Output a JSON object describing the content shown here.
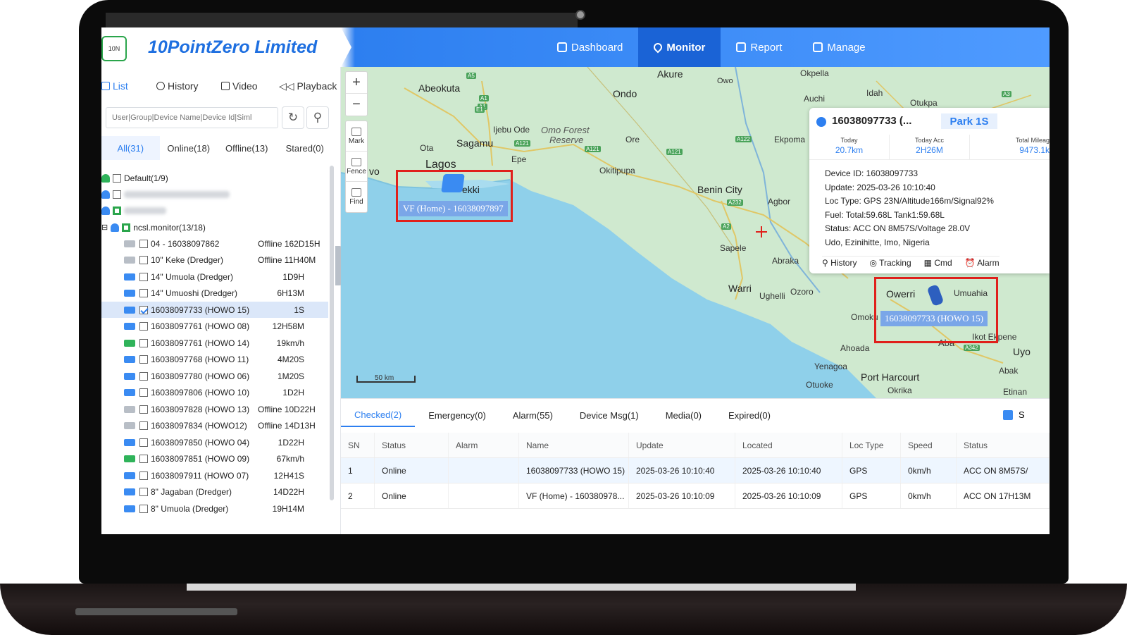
{
  "app": {
    "brand": "10PointZero Limited",
    "logo_text": "10N"
  },
  "nav": [
    {
      "label": "Dashboard",
      "icon": "monitor-icon",
      "active": false
    },
    {
      "label": "Monitor",
      "icon": "map-pin-icon",
      "active": true
    },
    {
      "label": "Report",
      "icon": "report-icon",
      "active": false
    },
    {
      "label": "Manage",
      "icon": "grid-icon",
      "active": false
    }
  ],
  "sidebar": {
    "tabs": [
      {
        "label": "List",
        "active": true
      },
      {
        "label": "History",
        "active": false
      },
      {
        "label": "Video",
        "active": false
      },
      {
        "label": "Playback",
        "active": false
      }
    ],
    "search_placeholder": "User|Group|Device Name|Device Id|Siml",
    "filters": [
      {
        "label": "All(31)",
        "active": true
      },
      {
        "label": "Online(18)",
        "active": false
      },
      {
        "label": "Offline(13)",
        "active": false
      },
      {
        "label": "Stared(0)",
        "active": false
      }
    ],
    "groups": {
      "default": "Default(1/9)",
      "monitor": "ncsl.monitor(13/18)"
    },
    "devices": [
      {
        "name": "04 - 16038097862",
        "status": "Offline 162D15H",
        "color": "gray",
        "checked": false,
        "selected": false
      },
      {
        "name": "10\" Keke (Dredger)",
        "status": "Offline 11H40M",
        "color": "gray",
        "checked": false,
        "selected": false
      },
      {
        "name": "14\" Umuola (Dredger)",
        "status": "1D9H",
        "color": "blue",
        "checked": false,
        "selected": false
      },
      {
        "name": "14\" Umuoshi (Dredger)",
        "status": "6H13M",
        "color": "blue",
        "checked": false,
        "selected": false
      },
      {
        "name": "16038097733 (HOWO 15)",
        "status": "1S",
        "color": "blue",
        "checked": true,
        "selected": true
      },
      {
        "name": "16038097761 (HOWO 08)",
        "status": "12H58M",
        "color": "blue",
        "checked": false,
        "selected": false
      },
      {
        "name": "16038097761 (HOWO 14)",
        "status": "19km/h",
        "color": "green",
        "checked": false,
        "selected": false
      },
      {
        "name": "16038097768 (HOWO 11)",
        "status": "4M20S",
        "color": "blue",
        "checked": false,
        "selected": false
      },
      {
        "name": "16038097780 (HOWO 06)",
        "status": "1M20S",
        "color": "blue",
        "checked": false,
        "selected": false
      },
      {
        "name": "16038097806 (HOWO 10)",
        "status": "1D2H",
        "color": "blue",
        "checked": false,
        "selected": false
      },
      {
        "name": "16038097828 (HOWO 13)",
        "status": "Offline 10D22H",
        "color": "gray",
        "checked": false,
        "selected": false
      },
      {
        "name": "16038097834 (HOWO12)",
        "status": "Offline 14D13H",
        "color": "gray",
        "checked": false,
        "selected": false
      },
      {
        "name": "16038097850 (HOWO 04)",
        "status": "1D22H",
        "color": "blue",
        "checked": false,
        "selected": false
      },
      {
        "name": "16038097851 (HOWO 09)",
        "status": "67km/h",
        "color": "green",
        "checked": false,
        "selected": false
      },
      {
        "name": "16038097911 (HOWO 07)",
        "status": "12H41S",
        "color": "blue",
        "checked": false,
        "selected": false
      },
      {
        "name": "8\" Jagaban (Dredger)",
        "status": "14D22H",
        "color": "blue",
        "checked": false,
        "selected": false
      },
      {
        "name": "8\" Umuola (Dredger)",
        "status": "19H14M",
        "color": "blue",
        "checked": false,
        "selected": false
      }
    ]
  },
  "map": {
    "controls": {
      "zoom_in": "+",
      "zoom_out": "−",
      "mark": "Mark",
      "fence": "Fence",
      "find": "Find"
    },
    "places": {
      "abeokuta": "Abeokuta",
      "akure": "Akure",
      "ondo": "Ondo",
      "owo": "Owo",
      "okpella": "Okpella",
      "auchi": "Auchi",
      "idah": "Idah",
      "otukpa": "Otukpa",
      "ijebu_ode": "Ijebu Ode",
      "omo_forest": "Omo Forest",
      "reserve": "Reserve",
      "sagamu": "Sagamu",
      "ota": "Ota",
      "lagos": "Lagos",
      "epe": "Epe",
      "ore": "Ore",
      "ekpoma": "Ekpoma",
      "okitipupa": "Okitipupa",
      "benin_city": "Benin City",
      "agbor": "Agbor",
      "sapele": "Sapele",
      "abraka": "Abraka",
      "warri": "Warri",
      "ughelli": "Ughelli",
      "ozoro": "Ozoro",
      "owerri": "Owerri",
      "umuahia": "Umuahia",
      "omoku": "Omoku",
      "ahoada": "Ahoada",
      "aba": "Aba",
      "ikot_ekpene": "Ikot Ekpene",
      "uyo": "Uyo",
      "yenagoa": "Yenagoa",
      "abak": "Abak",
      "port_harcourt": "Port Harcourt",
      "otuoke": "Otuoke",
      "okrika": "Okrika",
      "etinan": "Etinan",
      "vo": "vo",
      "ekki": "ekki"
    },
    "road_labels": [
      "A5",
      "A1",
      "A1",
      "E1",
      "A121",
      "A121",
      "A121",
      "A122",
      "A3",
      "A232",
      "A2",
      "A342"
    ],
    "vehicle_labels": {
      "home": "VF (Home) - 16038097897",
      "howo15": "16038097733 (HOWO 15)"
    },
    "scale": "50 km"
  },
  "popup": {
    "title": "16038097733 (...",
    "badge": "Park 1S",
    "stats": [
      {
        "label": "Today",
        "value": "20.7km"
      },
      {
        "label": "Today Acc",
        "value": "2H26M"
      },
      {
        "label": "Total Mileag",
        "value": "9473.1k"
      }
    ],
    "lines": [
      "Device ID: 16038097733",
      "Update: 2025-03-26 10:10:40",
      "Loc Type: GPS 23N/Altitude166m/Signal92%",
      "Fuel: Total:59.68L Tank1:59.68L",
      "Status: ACC ON 8M57S/Voltage 28.0V",
      "Udo, Ezinihitte, Imo, Nigeria"
    ],
    "actions": [
      "History",
      "Tracking",
      "Cmd",
      "Alarm"
    ]
  },
  "bottom": {
    "tabs": [
      {
        "label": "Checked(2)",
        "active": true
      },
      {
        "label": "Emergency(0)",
        "active": false
      },
      {
        "label": "Alarm(55)",
        "active": false
      },
      {
        "label": "Device Msg(1)",
        "active": false
      },
      {
        "label": "Media(0)",
        "active": false
      },
      {
        "label": "Expired(0)",
        "active": false
      }
    ],
    "columns": [
      "SN",
      "Status",
      "Alarm",
      "Name",
      "Update",
      "Located",
      "Loc Type",
      "Speed",
      "Status"
    ],
    "rows": [
      [
        "1",
        "Online",
        "",
        "16038097733 (HOWO 15)",
        "2025-03-26 10:10:40",
        "2025-03-26 10:10:40",
        "GPS",
        "0km/h",
        "ACC ON 8M57S/"
      ],
      [
        "2",
        "Online",
        "",
        "VF (Home) - 160380978...",
        "2025-03-26 10:10:09",
        "2025-03-26 10:10:09",
        "GPS",
        "0km/h",
        "ACC ON 17H13M"
      ]
    ],
    "trailing_label": "S"
  }
}
